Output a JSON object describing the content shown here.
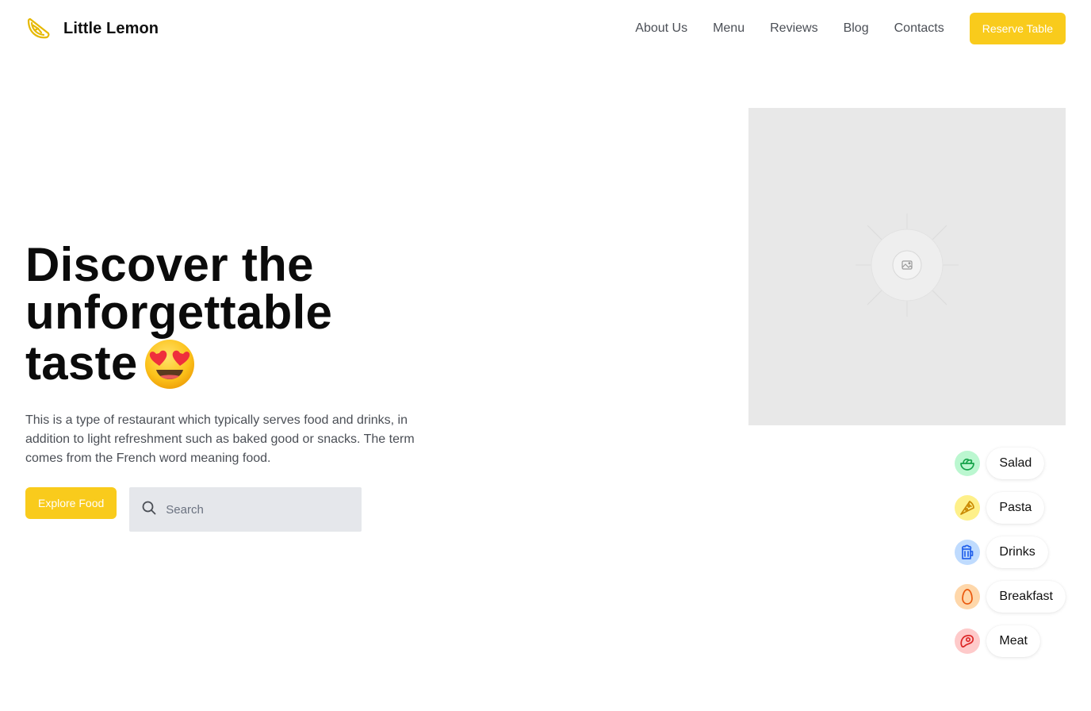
{
  "header": {
    "brand_name": "Little Lemon",
    "logo_icon": "lemon-slice-icon",
    "nav": [
      {
        "label": "About Us"
      },
      {
        "label": "Menu"
      },
      {
        "label": "Reviews"
      },
      {
        "label": "Blog"
      },
      {
        "label": "Contacts"
      }
    ],
    "reserve_label": "Reserve Table"
  },
  "hero": {
    "title": "Discover the unforgettable taste",
    "emoji_icon": "smiling-face-heart-eyes-icon",
    "description": "This is a type of restaurant which typically serves food and drinks, in addition to light refreshment such as baked good or snacks. The term comes from the French word meaning food.",
    "explore_label": "Explore Food",
    "search_placeholder": "Search",
    "search_value": "",
    "image_icon": "image-placeholder-icon"
  },
  "categories": [
    {
      "label": "Salad",
      "icon": "salad-bowl-icon",
      "color": "#16a34a",
      "bg": "#bbf7d0"
    },
    {
      "label": "Pasta",
      "icon": "pizza-slice-icon",
      "color": "#ca8a04",
      "bg": "#fef08a"
    },
    {
      "label": "Drinks",
      "icon": "beer-mug-icon",
      "color": "#2563eb",
      "bg": "#bfdbfe"
    },
    {
      "label": "Breakfast",
      "icon": "egg-icon",
      "color": "#ea580c",
      "bg": "#fed7aa"
    },
    {
      "label": "Meat",
      "icon": "steak-icon",
      "color": "#dc2626",
      "bg": "#fecaca"
    }
  ],
  "colors": {
    "accent": "#f9cb1c",
    "text_muted": "#4b4f56",
    "placeholder_bg": "#e8e8e8"
  }
}
